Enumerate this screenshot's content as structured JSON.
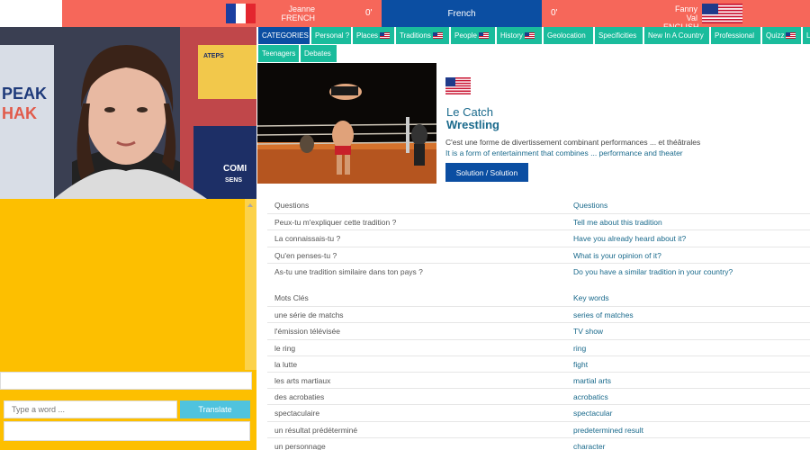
{
  "topbar": {
    "left_user": {
      "name": "Jeanne",
      "language": "FRENCH",
      "score": "0'"
    },
    "session_language": "French",
    "right_user": {
      "name": "Fanny Val",
      "language": "ENGLISH",
      "score": "0'"
    }
  },
  "categories": [
    {
      "label": "CATEGORIES",
      "flag": false,
      "active": true
    },
    {
      "label": "Personal ?",
      "flag": false,
      "active": false
    },
    {
      "label": "Places",
      "flag": true,
      "active": false
    },
    {
      "label": "Traditions",
      "flag": true,
      "active": false
    },
    {
      "label": "People",
      "flag": true,
      "active": false
    },
    {
      "label": "History",
      "flag": true,
      "active": false
    },
    {
      "label": "Geolocation",
      "flag": false,
      "active": false
    },
    {
      "label": "Specificities",
      "flag": false,
      "active": false
    },
    {
      "label": "New In A Country",
      "flag": false,
      "active": false
    },
    {
      "label": "Professional",
      "flag": false,
      "active": false
    },
    {
      "label": "Quizz",
      "flag": true,
      "active": false
    },
    {
      "label": "L",
      "flag": false,
      "active": false
    },
    {
      "label": "Teenagers",
      "flag": false,
      "active": false
    },
    {
      "label": "Debates",
      "flag": false,
      "active": false
    }
  ],
  "card": {
    "title_fr": "Le Catch",
    "title_en": "Wrestling",
    "desc_fr": "C'est une forme de divertissement combinant performances ... et théâtrales",
    "desc_en": "It is a form of entertainment that combines ... performance and theater",
    "solution_label": "Solution / Solution"
  },
  "questions": {
    "header_fr": "Questions",
    "header_en": "Questions",
    "rows": [
      {
        "fr": "Peux-tu m'expliquer cette tradition ?",
        "en": "Tell me about this tradition"
      },
      {
        "fr": "La connaissais-tu ?",
        "en": "Have you already heard about it?"
      },
      {
        "fr": "Qu'en penses-tu ?",
        "en": "What is your opinion of it?"
      },
      {
        "fr": "As-tu une tradition similaire dans ton pays ?",
        "en": "Do you have a similar tradition in your country?"
      }
    ]
  },
  "keywords": {
    "header_fr": "Mots Clés",
    "header_en": "Key words",
    "rows": [
      {
        "fr": "une série de matchs",
        "en": "series of matches"
      },
      {
        "fr": "l'émission télévisée",
        "en": "TV show"
      },
      {
        "fr": "le ring",
        "en": "ring"
      },
      {
        "fr": "la lutte",
        "en": "fight"
      },
      {
        "fr": "les arts martiaux",
        "en": "martial arts"
      },
      {
        "fr": "des acrobaties",
        "en": "acrobatics"
      },
      {
        "fr": "spectaculaire",
        "en": "spectacular"
      },
      {
        "fr": "un résultat prédéterminé",
        "en": "predetermined result"
      },
      {
        "fr": "un personnage",
        "en": "character"
      }
    ]
  },
  "translator": {
    "placeholder": "Type a word ...",
    "button_label": "Translate"
  },
  "colors": {
    "coral": "#f6675a",
    "navy": "#0b4ea2",
    "teal": "#1abc9c",
    "yellow": "#fdbf00",
    "cyan": "#4fc3de"
  },
  "video_watermark": [
    "PEAK",
    "HAK",
    "ATEPS",
    "COMI",
    "SENS"
  ]
}
